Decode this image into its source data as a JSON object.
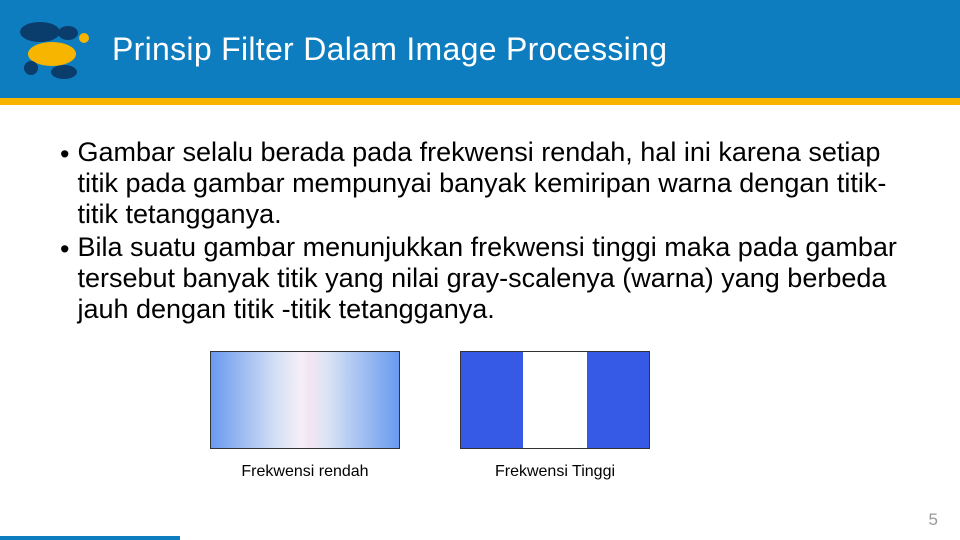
{
  "header": {
    "title": "Prinsip Filter Dalam Image Processing"
  },
  "bullets": {
    "b1": "Gambar selalu berada pada frekwensi rendah, hal ini karena setiap titik pada gambar mempunyai banyak kemiripan warna dengan titik-titik tetangganya.",
    "b2": "Bila suatu gambar menunjukkan frekwensi tinggi maka pada gambar tersebut banyak titik yang nilai gray-scalenya (warna) yang berbeda jauh dengan titik -titik tetangganya."
  },
  "figures": {
    "low_caption": "Frekwensi rendah",
    "high_caption": "Frekwensi Tinggi"
  },
  "page_number": "5",
  "colors": {
    "header_bg": "#0d7dbf",
    "accent": "#f7b500"
  }
}
